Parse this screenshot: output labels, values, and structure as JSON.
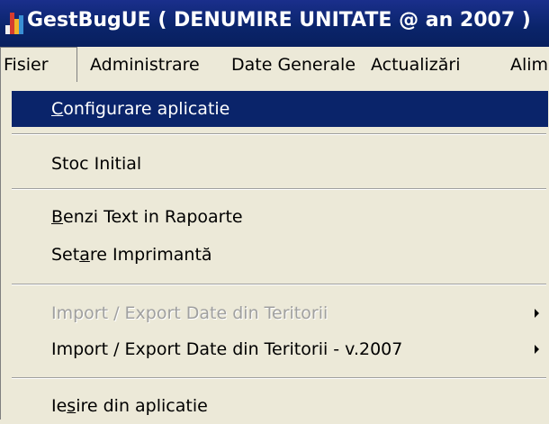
{
  "titlebar": {
    "title": "GestBugUE ( DENUMIRE UNITATE @ an 2007 )"
  },
  "menubar": {
    "items": [
      "Fisier",
      "Administrare",
      "Date Generale",
      "Actualizări",
      "Alim"
    ]
  },
  "dropdown": {
    "items": [
      {
        "pre": "",
        "acc": "C",
        "post": "onfigurare aplicatie",
        "state": "selected"
      },
      {
        "pre": "Stoc Initial",
        "acc": "",
        "post": "",
        "state": "normal"
      },
      {
        "pre": "",
        "acc": "B",
        "post": "enzi Text in Rapoarte",
        "state": "normal"
      },
      {
        "pre": "Set",
        "acc": "a",
        "post": "re Imprimantă",
        "state": "normal"
      },
      {
        "pre": "Import / Export Date din Teritorii",
        "acc": "",
        "post": "",
        "state": "disabled",
        "submenu": true
      },
      {
        "pre": "Import / Export Date din Teritorii - v.2007",
        "acc": "",
        "post": "",
        "state": "normal",
        "submenu": true
      },
      {
        "pre": "Ie",
        "acc": "s",
        "post": "ire din aplicatie",
        "state": "normal"
      }
    ]
  },
  "colors": {
    "titlebar": "#0a246a",
    "highlight": "#0a246a",
    "menu_bg": "#ece9d8",
    "disabled_text": "#a0a0a0",
    "icon_bars": [
      "#d63c2f",
      "#f0f0f0",
      "#3a8fd4",
      "#f0b428"
    ]
  },
  "icons": {
    "app": "bar-chart-icon",
    "submenu": "triangle-right-icon"
  }
}
